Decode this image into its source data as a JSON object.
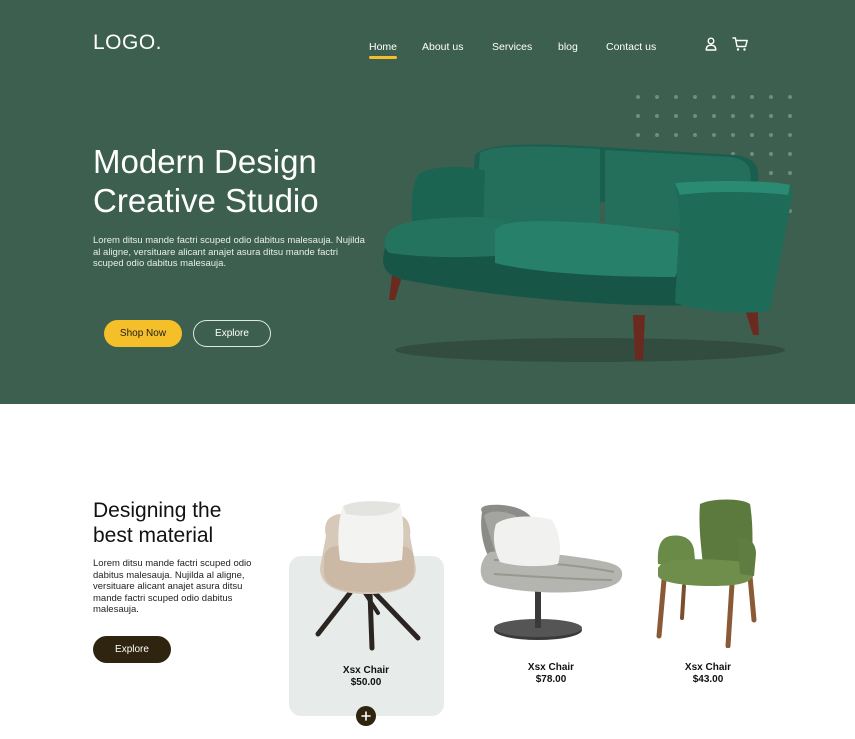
{
  "header": {
    "logo": "LOGO.",
    "nav": [
      {
        "label": "Home",
        "active": true
      },
      {
        "label": "About us",
        "active": false
      },
      {
        "label": "Services",
        "active": false
      },
      {
        "label": "blog",
        "active": false
      },
      {
        "label": "Contact us",
        "active": false
      }
    ],
    "icons": [
      "user-icon",
      "cart-icon"
    ]
  },
  "hero": {
    "title_line1": "Modern Design",
    "title_line2": "Creative Studio",
    "description": "Lorem ditsu mande factri scuped odio dabitus malesauja. Nujilda al aligne, versituare alicant anajet asura ditsu mande factri scuped odio dabitus malesauja.",
    "primary_button": "Shop Now",
    "secondary_button": "Explore"
  },
  "section": {
    "title_line1": "Designing the",
    "title_line2": "best material",
    "description": "Lorem ditsu mande factri scuped odio dabitus malesauja. Nujilda al aligne, versituare alicant anajet asura ditsu mande factri scuped odio dabitus malesauja.",
    "button": "Explore"
  },
  "products": [
    {
      "name": "Xsx Chair",
      "price": "$50.00",
      "highlighted": true
    },
    {
      "name": "Xsx Chair",
      "price": "$78.00",
      "highlighted": false
    },
    {
      "name": "Xsx Chair",
      "price": "$43.00",
      "highlighted": false
    }
  ],
  "colors": {
    "hero_bg": "#3d5f4f",
    "accent": "#f5bf2a",
    "dark_button": "#2e2410",
    "card_bg": "#e7ebe9",
    "sofa": "#1f6b59"
  }
}
